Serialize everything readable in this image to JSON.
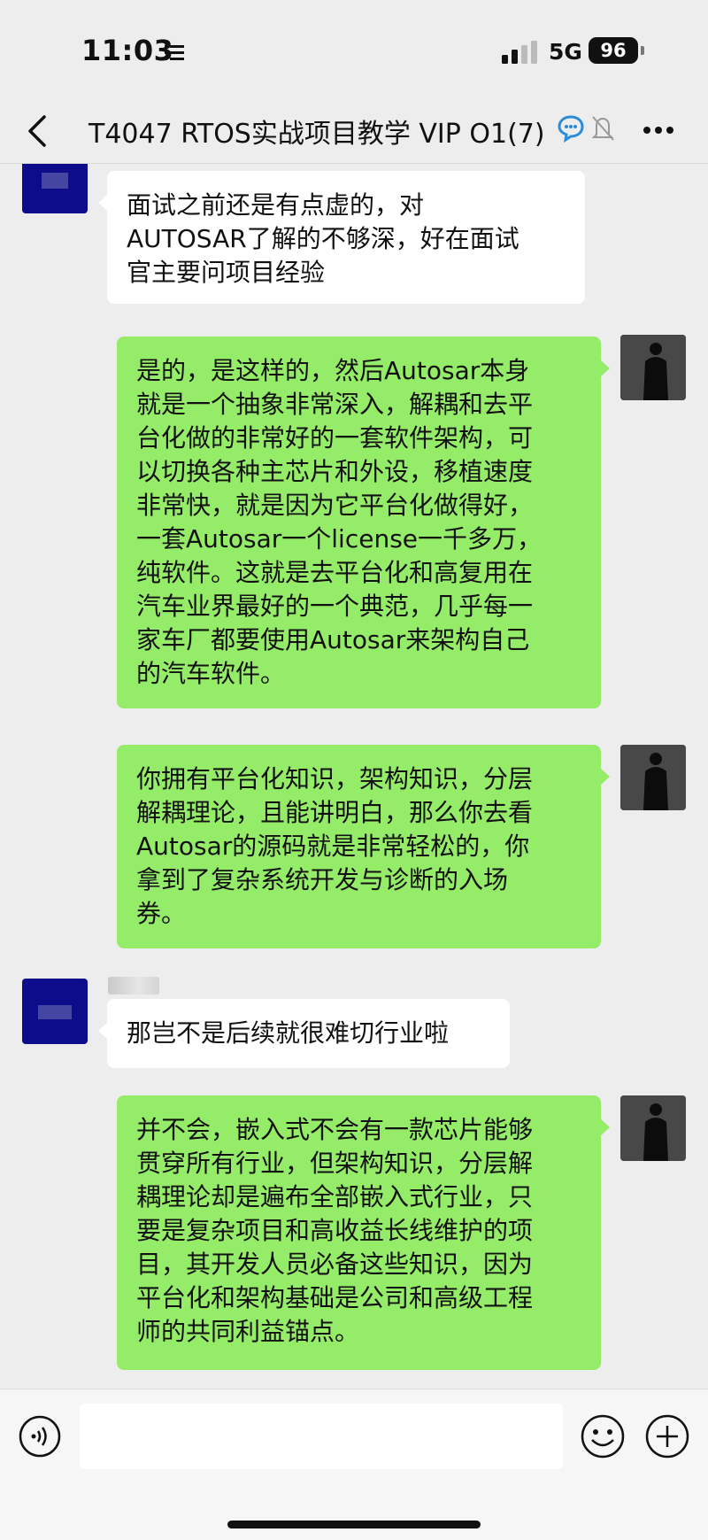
{
  "status": {
    "time": "11:03",
    "network": "5G",
    "battery": "96"
  },
  "header": {
    "title": "T4047 RTOS实战项目教学 VIP O1(7)"
  },
  "messages": [
    {
      "side": "left",
      "text": "面试之前还是有点虚的，对\nAUTOSAR了解的不够深，好在面试\n官主要问项目经验"
    },
    {
      "side": "right",
      "text": "是的，是这样的，然后Autosar本身\n就是一个抽象非常深入，解耦和去平\n台化做的非常好的一套软件架构，可\n以切换各种主芯片和外设，移植速度\n非常快，就是因为它平台化做得好，\n一套Autosar一个license一千多万，\n纯软件。这就是去平台化和高复用在\n汽车业界最好的一个典范，几乎每一\n家车厂都要使用Autosar来架构自己\n的汽车软件。"
    },
    {
      "side": "right",
      "text": "你拥有平台化知识，架构知识，分层\n解耦理论，且能讲明白，那么你去看\nAutosar的源码就是非常轻松的，你\n拿到了复杂系统开发与诊断的入场\n券。"
    },
    {
      "side": "left",
      "text": "那岂不是后续就很难切行业啦"
    },
    {
      "side": "right",
      "text": "并不会，嵌入式不会有一款芯片能够\n贯穿所有行业，但架构知识，分层解\n耦理论却是遍布全部嵌入式行业，只\n要是复杂项目和高收益长线维护的项\n目，其开发人员必备这些知识，因为\n平台化和架构基础是公司和高级工程\n师的共同利益锚点。"
    }
  ],
  "input": {
    "placeholder": ""
  },
  "colors": {
    "background": "#ededed",
    "bubble_self": "#95ec69",
    "bubble_other": "#ffffff",
    "avatar_other": "#0d0d8c"
  }
}
